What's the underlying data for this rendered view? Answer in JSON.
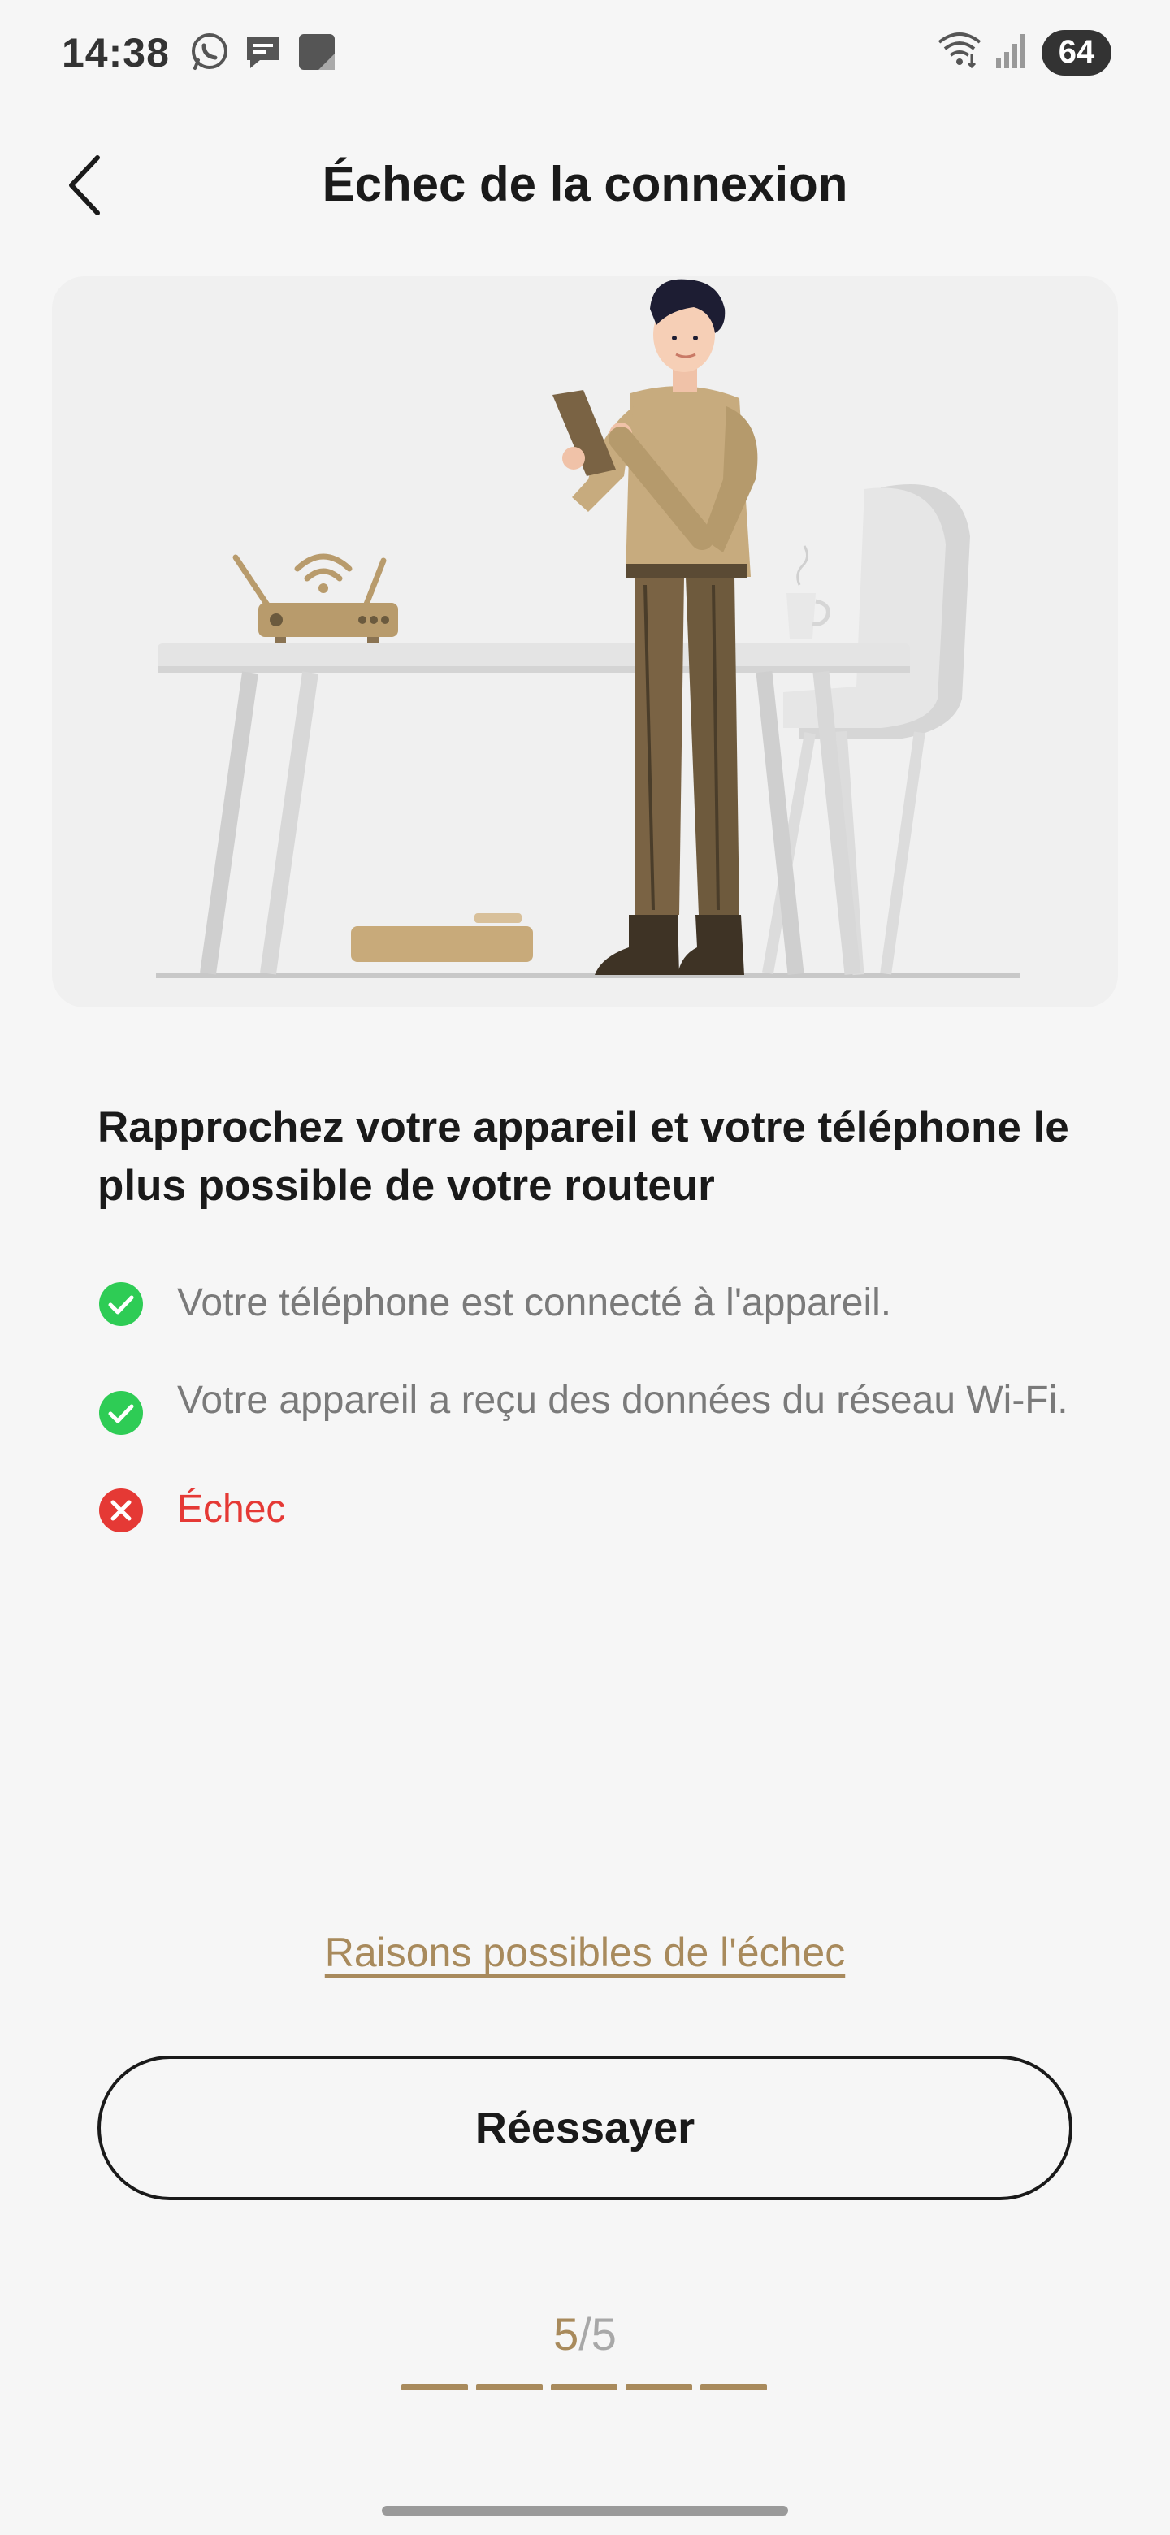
{
  "status_bar": {
    "time": "14:38",
    "battery": "64",
    "icons_left": [
      "whatsapp-icon",
      "message-icon",
      "note-icon"
    ],
    "icons_right": [
      "wifi-icon",
      "signal-icon"
    ]
  },
  "header": {
    "title": "Échec de la connexion",
    "back_icon": "chevron-left-icon"
  },
  "illustration": {
    "subject": "person-router-table-illustration"
  },
  "content": {
    "headline": "Rapprochez votre appareil et votre téléphone le plus possible de votre routeur",
    "steps": [
      {
        "text": "Votre téléphone est connecté à l'appareil.",
        "status": "success"
      },
      {
        "text": "Votre appareil a reçu des données du réseau Wi-Fi.",
        "status": "success"
      },
      {
        "text": "Échec",
        "status": "error"
      }
    ]
  },
  "links": {
    "reasons": "Raisons possibles de l'échec"
  },
  "actions": {
    "retry": "Réessayer"
  },
  "progress": {
    "current": "5",
    "separator": "/",
    "total": "5",
    "segments_filled": 5
  },
  "colors": {
    "accent": "#a88a5c",
    "success": "#2ecc55",
    "error": "#e53935",
    "text_primary": "#1a1a1a",
    "text_secondary": "#7a7a7a",
    "background": "#f6f6f6"
  }
}
